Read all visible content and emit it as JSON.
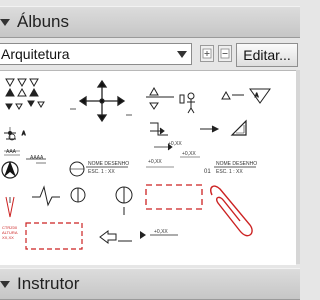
{
  "albums": {
    "title": "Álbuns",
    "selected_album": "Arquitetura",
    "edit_label": "Editar..."
  },
  "instructor": {
    "title": "Instrutor"
  },
  "symbols": [
    "triangle-markers-symbol",
    "axis-cross-symbol",
    "level-triangle-symbol",
    "person-symbol",
    "elevation-triangle-symbol",
    "section-line-symbol",
    "corner-triangle-symbol",
    "north-arrow-symbol",
    "drawing-title-block-symbol",
    "break-line-symbol",
    "circle-marker-symbol",
    "dashed-rectangle-symbol",
    "cutting-line-symbol",
    "arrow-symbol",
    "paperclip-symbol"
  ]
}
